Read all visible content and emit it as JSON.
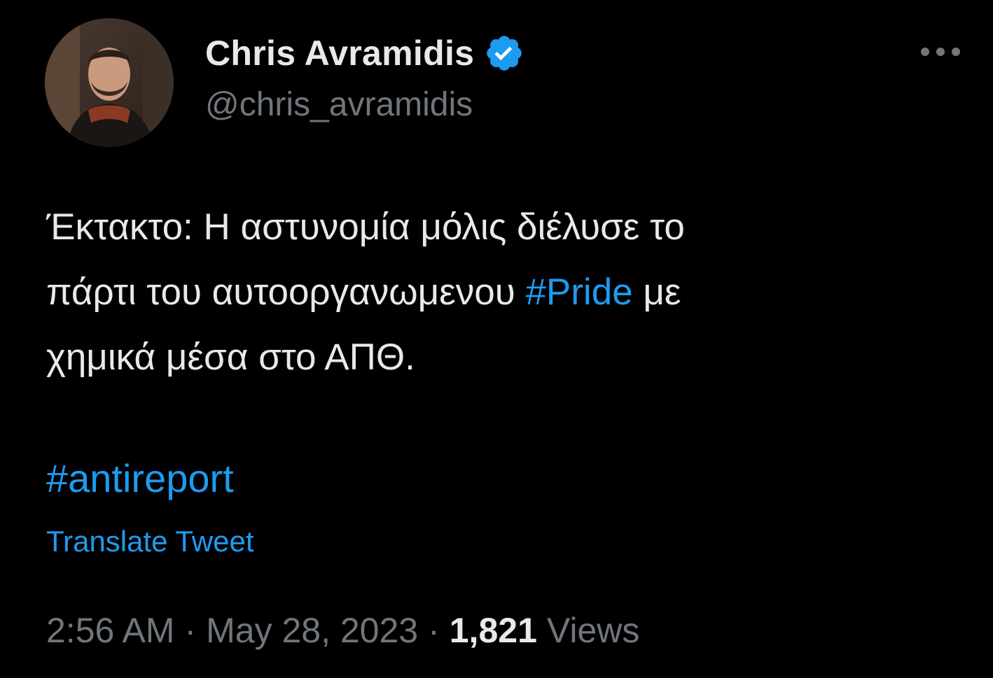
{
  "author": {
    "display_name": "Chris Avramidis",
    "handle": "@chris_avramidis",
    "verified": true,
    "avatar_icon": "profile-photo",
    "badge_color": "#1d9bf0"
  },
  "menu": {
    "more_icon": "more-horizontal-icon"
  },
  "tweet": {
    "line1": "Έκτακτο: Η αστυνομία μόλις διέλυσε το",
    "line2_before": "πάρτι του αυτοοργανωμενου ",
    "line2_hashtag": "#Pride",
    "line2_after": " με",
    "line3": "χημικά μέσα στο ΑΠΘ.",
    "hashtag_line": "#antireport"
  },
  "translate_label": "Translate Tweet",
  "meta": {
    "time": "2:56 AM",
    "separator": "·",
    "date": "May 28, 2023",
    "views_count": "1,821",
    "views_label": "Views"
  },
  "colors": {
    "background": "#000000",
    "text": "#e7e9ea",
    "secondary": "#71767b",
    "link": "#1d9bf0"
  }
}
